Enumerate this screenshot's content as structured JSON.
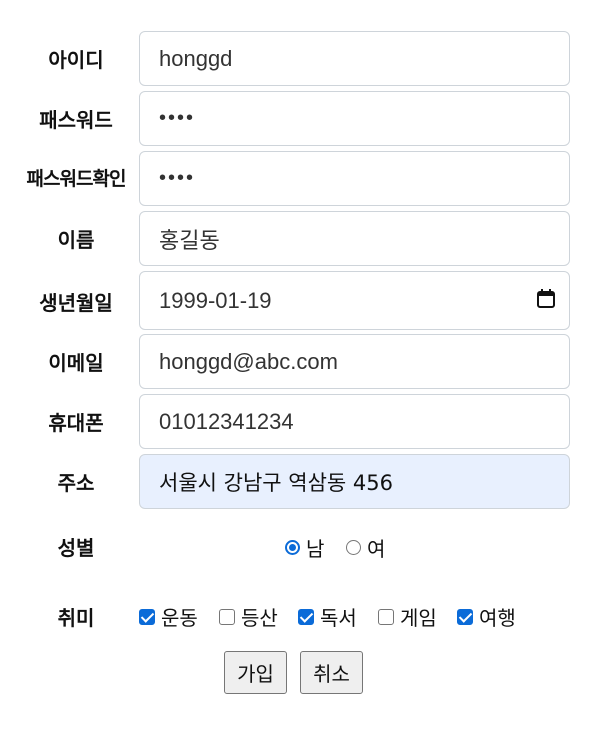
{
  "form": {
    "userid": {
      "label": "아이디",
      "value": "honggd"
    },
    "password": {
      "label": "패스워드",
      "value": "••••"
    },
    "password_confirm": {
      "label": "패스워드확인",
      "value": "••••"
    },
    "name": {
      "label": "이름",
      "value": "홍길동"
    },
    "birth": {
      "label": "생년월일",
      "value": "1999-01-19"
    },
    "email": {
      "label": "이메일",
      "value": "honggd@abc.com"
    },
    "phone": {
      "label": "휴대폰",
      "value": "01012341234"
    },
    "address": {
      "label": "주소",
      "value": "서울시 강남구 역삼동 456"
    },
    "gender": {
      "label": "성별",
      "options": [
        {
          "label": "남",
          "checked": true
        },
        {
          "label": "여",
          "checked": false
        }
      ]
    },
    "hobby": {
      "label": "취미",
      "options": [
        {
          "label": "운동",
          "checked": true
        },
        {
          "label": "등산",
          "checked": false
        },
        {
          "label": "독서",
          "checked": true
        },
        {
          "label": "게임",
          "checked": false
        },
        {
          "label": "여행",
          "checked": true
        }
      ]
    },
    "submit_label": "가입",
    "cancel_label": "취소"
  },
  "icons": {
    "date_picker": "calendar-icon"
  },
  "colors": {
    "accent": "#0b6bd8",
    "autofill": "#e8f0fe"
  }
}
